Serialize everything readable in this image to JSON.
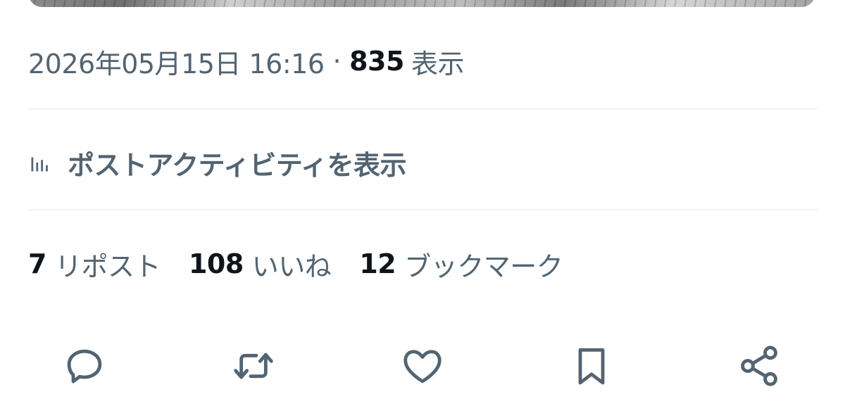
{
  "tweet": {
    "timestamp": "2026年05月15日 16:16",
    "separator": "·",
    "views_count": "835",
    "views_label": "表示"
  },
  "activity": {
    "label": "ポストアクティビティを表示",
    "icon": "analytics-icon"
  },
  "stats": [
    {
      "count": "7",
      "label": "リポスト"
    },
    {
      "count": "108",
      "label": "いいね"
    },
    {
      "count": "12",
      "label": "ブックマーク"
    }
  ],
  "actions": [
    {
      "icon": "reply-icon"
    },
    {
      "icon": "repost-icon"
    },
    {
      "icon": "like-icon"
    },
    {
      "icon": "bookmark-icon"
    },
    {
      "icon": "share-icon"
    }
  ],
  "colors": {
    "primary_text": "#0f1419",
    "secondary_text": "#536471",
    "divider": "#eff3f4",
    "background": "#ffffff"
  }
}
